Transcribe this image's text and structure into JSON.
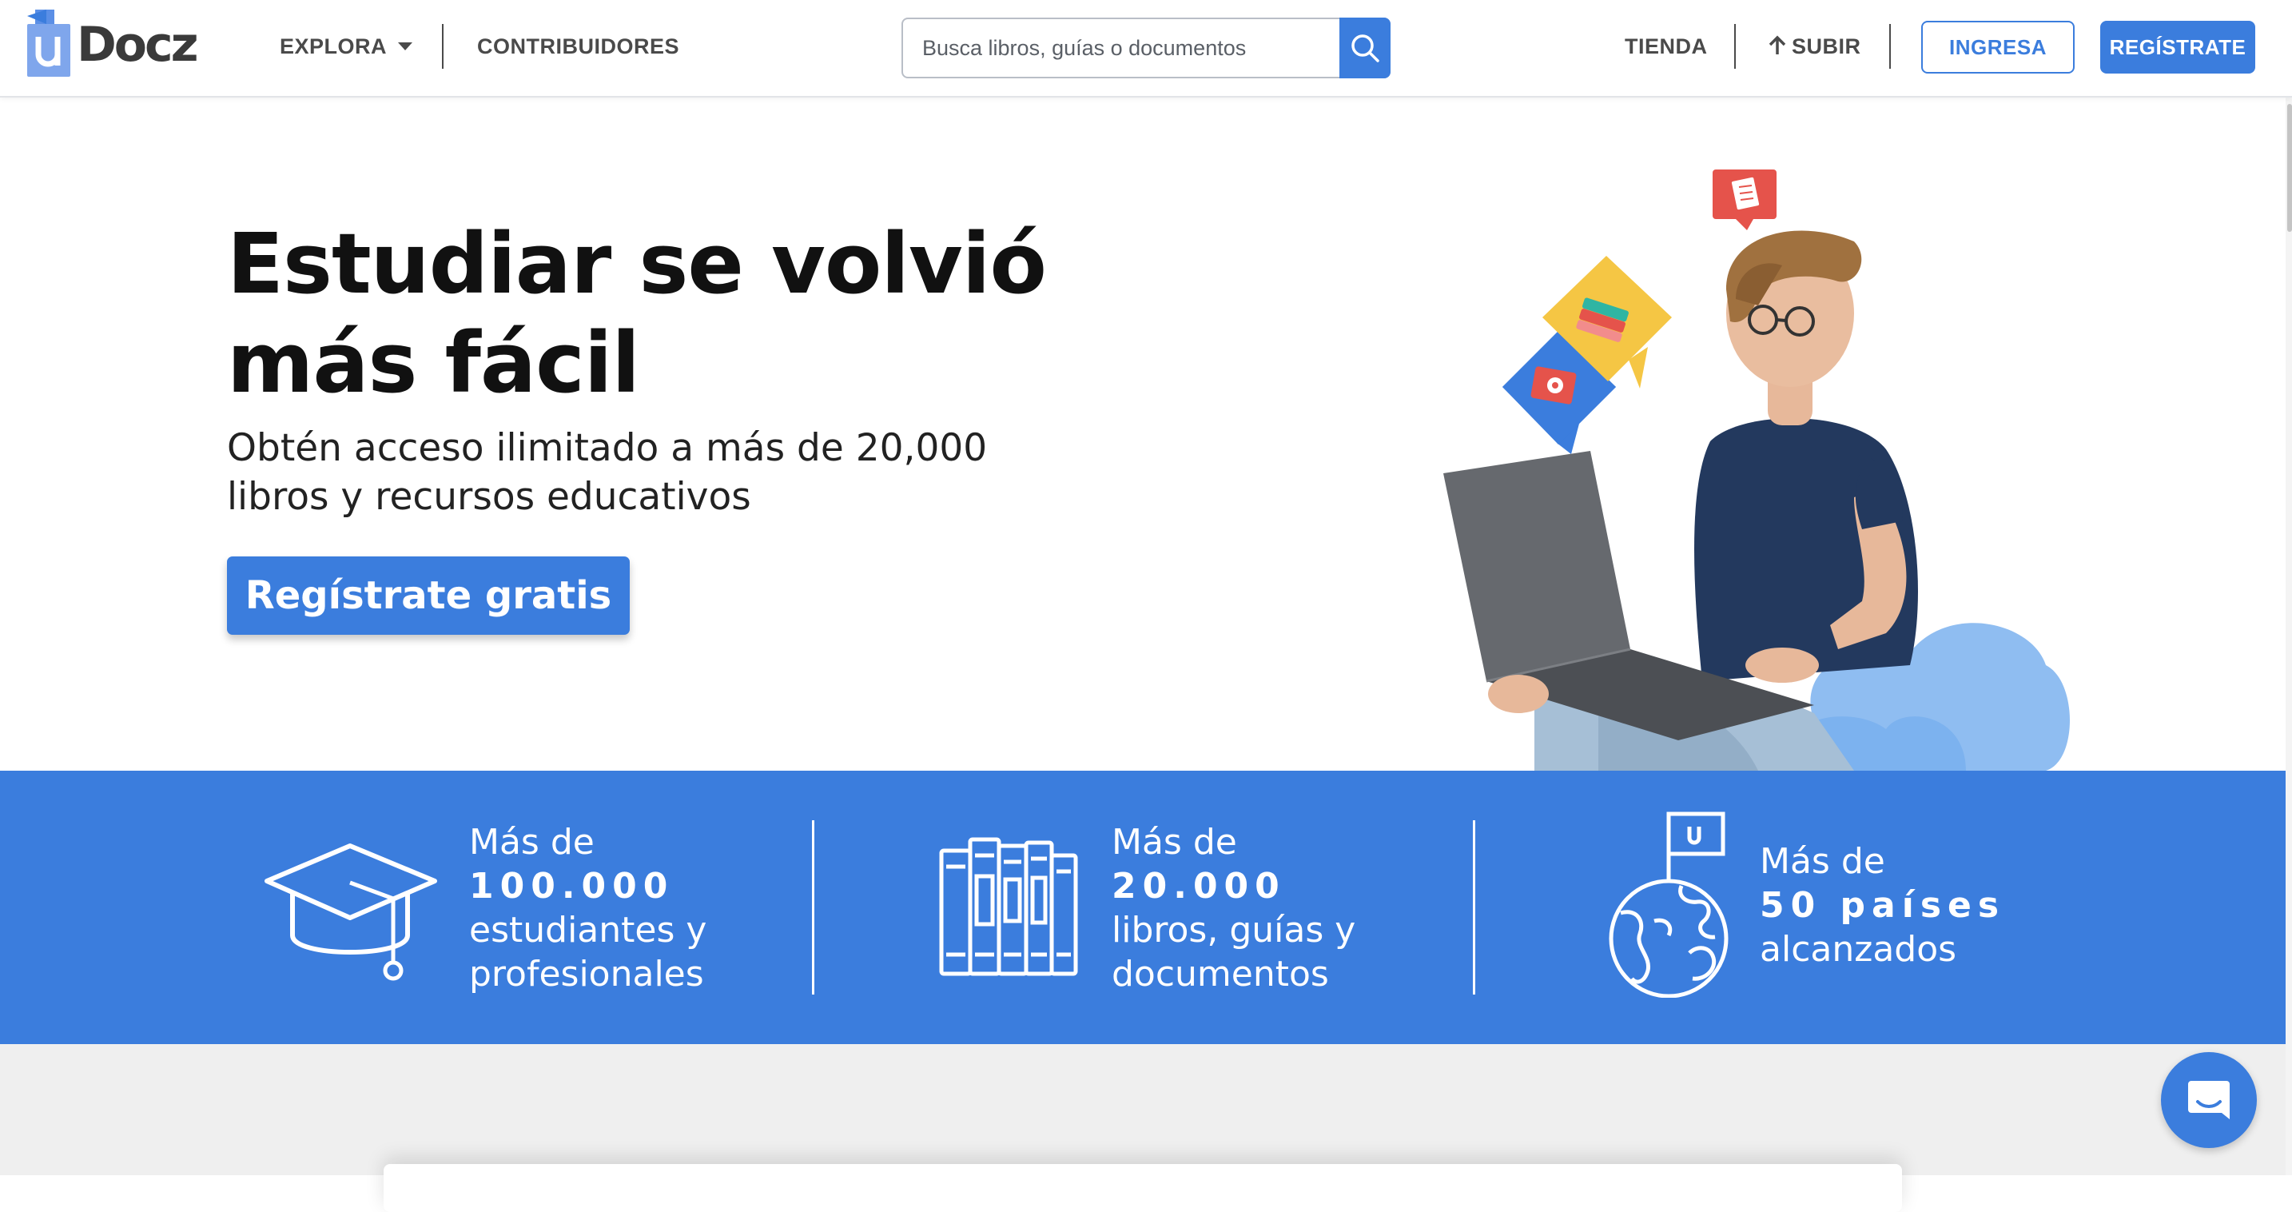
{
  "header": {
    "logo": {
      "letter": "u",
      "text": "Docz"
    },
    "nav": {
      "explora": "EXPLORA",
      "contribuidores": "CONTRIBUIDORES",
      "tienda": "TIENDA",
      "subir": "SUBIR",
      "subir_icon": "arrow-up-icon"
    },
    "search": {
      "placeholder": "Busca libros, guías o documentos",
      "value": "",
      "icon": "search-icon"
    },
    "ingresa_label": "INGRESA",
    "registrate_label": "REGÍSTRATE"
  },
  "hero": {
    "title_line1": "Estudiar se volvió",
    "title_line2": "más fácil",
    "subtitle_line1": "Obtén acceso ilimitado a más de 20,000",
    "subtitle_line2": "libros y recursos educativos",
    "cta_label": "Regístrate gratis",
    "illustration": "student-with-laptop"
  },
  "stats": [
    {
      "icon": "graduation-cap-icon",
      "prefix": "Más de",
      "number": "100.000",
      "line1": "estudiantes y",
      "line2": "profesionales"
    },
    {
      "icon": "books-icon",
      "prefix": "Más de",
      "number": "20.000",
      "line1": "libros, guías y",
      "line2": "documentos"
    },
    {
      "icon": "globe-flag-icon",
      "prefix": "Más de",
      "number": "50 países",
      "line1": "alcanzados",
      "line2": ""
    }
  ],
  "chat": {
    "icon": "chat-icon"
  },
  "colors": {
    "brand_blue": "#3b7ddd",
    "text_dark": "#111111",
    "nav_gray": "#4a4a4a",
    "lower_bg": "#efefef"
  }
}
